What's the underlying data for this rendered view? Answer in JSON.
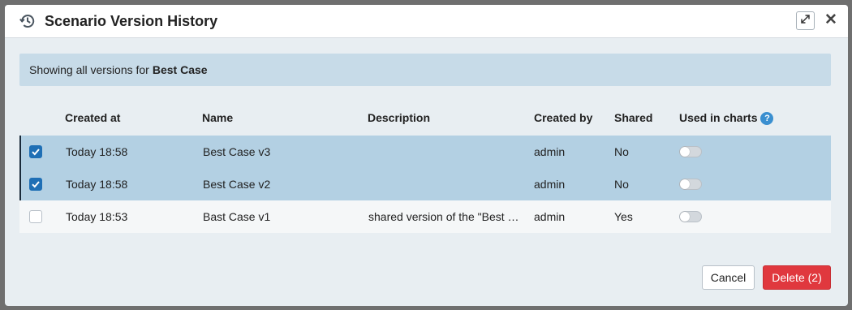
{
  "dialog": {
    "title": "Scenario Version History",
    "icons": {
      "header": "history-icon",
      "expand": "expand-icon",
      "close": "close-icon"
    },
    "close_glyph": "✕"
  },
  "info": {
    "prefix": "Showing all versions for",
    "scenario": "Best Case"
  },
  "table": {
    "headers": {
      "created_at": "Created at",
      "name": "Name",
      "description": "Description",
      "created_by": "Created by",
      "shared": "Shared",
      "used_in_charts": "Used in charts"
    },
    "help_glyph": "?",
    "rows": [
      {
        "selected": true,
        "created_at": "Today 18:58",
        "name": "Best Case v3",
        "description": "",
        "created_by": "admin",
        "shared": "No",
        "used_in_charts": false
      },
      {
        "selected": true,
        "created_at": "Today 18:58",
        "name": "Best Case v2",
        "description": "",
        "created_by": "admin",
        "shared": "No",
        "used_in_charts": false
      },
      {
        "selected": false,
        "created_at": "Today 18:53",
        "name": "Bast Case v1",
        "description": "shared version of the \"Best …",
        "created_by": "admin",
        "shared": "Yes",
        "used_in_charts": false
      }
    ]
  },
  "buttons": {
    "cancel": "Cancel",
    "delete": "Delete (2)"
  },
  "colors": {
    "selected_row": "#b3d0e3",
    "checkbox_checked": "#1f6fb5",
    "delete_button": "#e0383e",
    "help_icon": "#3a8fd0"
  }
}
